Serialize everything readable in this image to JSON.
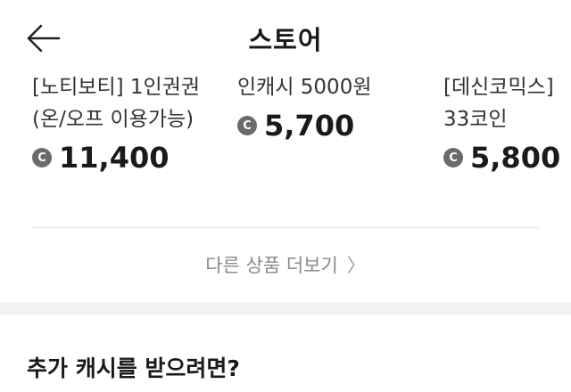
{
  "header": {
    "title": "스토어"
  },
  "products": [
    {
      "name_line1": "[노티보티] 1인권권",
      "name_line2": "(온/오프 이용가능)",
      "price": "11,400"
    },
    {
      "name_line1": "인캐시 5000원",
      "name_line2": "",
      "price": "5,700"
    },
    {
      "name_line1": "[데신코믹스]",
      "name_line2": "33코인",
      "price": "5,800"
    }
  ],
  "coin_symbol": "C",
  "more": {
    "label": "다른 상품 더보기",
    "chevron": "〉"
  },
  "extra_cash": {
    "title": "추가 캐시를 받으려면?"
  },
  "icons": {
    "back": "arrow-left-icon",
    "coin": "coin-icon",
    "more": "chevron-right-icon"
  }
}
